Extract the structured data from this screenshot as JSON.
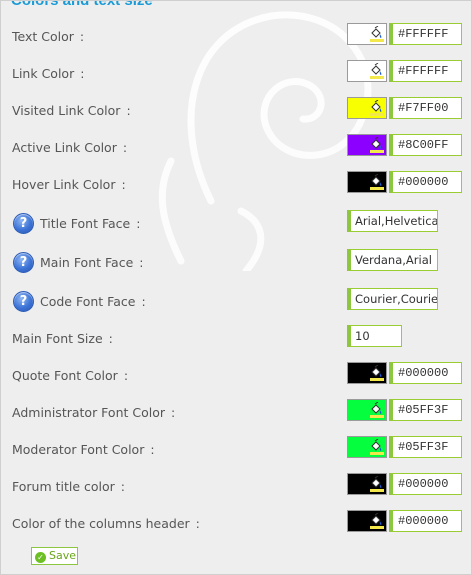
{
  "section": {
    "title": "Colors and text size"
  },
  "rows": [
    {
      "label": "Text Color",
      "colon": ":",
      "type": "color",
      "value": "#FFFFFF",
      "swatch": "#FFFFFF"
    },
    {
      "label": "Link Color",
      "colon": ":",
      "type": "color",
      "value": "#FFFFFF",
      "swatch": "#FFFFFF"
    },
    {
      "label": "Visited Link Color",
      "colon": ":",
      "type": "color",
      "value": "#F7FF00",
      "swatch": "#F7FF00"
    },
    {
      "label": "Active Link Color",
      "colon": ":",
      "type": "color",
      "value": "#8C00FF",
      "swatch": "#8C00FF"
    },
    {
      "label": "Hover Link Color",
      "colon": ":",
      "type": "color",
      "value": "#000000",
      "swatch": "#000000"
    },
    {
      "label": "Title Font Face",
      "colon": ":",
      "type": "text",
      "help": true,
      "value": "Arial,Helvetica"
    },
    {
      "label": "Main Font Face",
      "colon": ":",
      "type": "text",
      "help": true,
      "value": "Verdana,Arial"
    },
    {
      "label": "Code Font Face",
      "colon": ":",
      "type": "text",
      "help": true,
      "value": "Courier,Courier"
    },
    {
      "label": "Main Font Size",
      "colon": ":",
      "type": "text-small",
      "value": "10"
    },
    {
      "label": "Quote Font Color",
      "colon": ":",
      "type": "color",
      "value": "#000000",
      "swatch": "#000000"
    },
    {
      "label": "Administrator Font Color",
      "colon": ":",
      "type": "color",
      "value": "#05FF3F",
      "swatch": "#05FF3F"
    },
    {
      "label": "Moderator Font Color",
      "colon": ":",
      "type": "color",
      "value": "#05FF3F",
      "swatch": "#05FF3F"
    },
    {
      "label": "Forum title color",
      "colon": ":",
      "type": "color",
      "value": "#000000",
      "swatch": "#000000"
    },
    {
      "label": "Color of the columns header",
      "colon": ":",
      "type": "color",
      "value": "#000000",
      "swatch": "#000000"
    }
  ],
  "help_glyph": "?",
  "save": {
    "label": "Save",
    "icon": "check-circle-icon"
  },
  "theme": {
    "accent": "#1A9AD6",
    "field_border": "#8DC63F"
  }
}
